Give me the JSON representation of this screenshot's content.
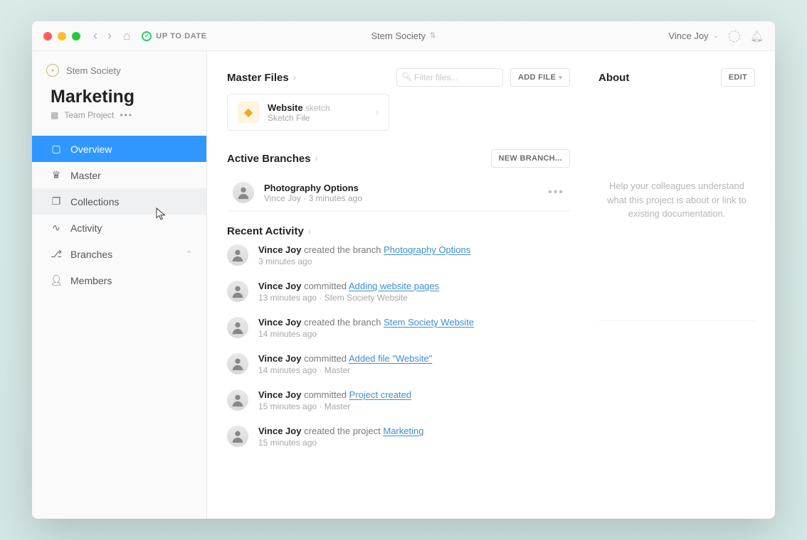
{
  "titlebar": {
    "status_label": "UP TO DATE",
    "center_title": "Stem Society",
    "user_name": "Vince Joy"
  },
  "sidebar": {
    "org_name": "Stem Society",
    "project_title": "Marketing",
    "project_subtitle": "Team Project",
    "items": [
      {
        "label": "Overview"
      },
      {
        "label": "Master"
      },
      {
        "label": "Collections"
      },
      {
        "label": "Activity"
      },
      {
        "label": "Branches"
      },
      {
        "label": "Members"
      }
    ]
  },
  "master_files": {
    "heading": "Master Files",
    "filter_placeholder": "Filter files...",
    "add_button": "ADD FILE",
    "file": {
      "name": "Website",
      "ext": ".sketch",
      "type": "Sketch File"
    }
  },
  "branches": {
    "heading": "Active Branches",
    "new_button": "NEW BRANCH...",
    "item": {
      "name": "Photography Options",
      "author": "Vince Joy",
      "time": "3 minutes ago"
    }
  },
  "recent": {
    "heading": "Recent Activity",
    "items": [
      {
        "who": "Vince Joy",
        "action": " created the branch ",
        "link": "Photography Options",
        "sub": "3 minutes ago"
      },
      {
        "who": "Vince Joy",
        "action": " committed ",
        "link": "Adding website pages",
        "sub": "13 minutes ago · Stem Society Website"
      },
      {
        "who": "Vince Joy",
        "action": " created the branch ",
        "link": "Stem Society Website",
        "sub": "14 minutes ago"
      },
      {
        "who": "Vince Joy",
        "action": " committed ",
        "link": "Added file \"Website\"",
        "sub": "14 minutes ago · Master"
      },
      {
        "who": "Vince Joy",
        "action": " committed ",
        "link": "Project created",
        "sub": "15 minutes ago · Master"
      },
      {
        "who": "Vince Joy",
        "action": " created the project ",
        "link": "Marketing",
        "sub": "15 minutes ago"
      }
    ]
  },
  "about": {
    "heading": "About",
    "edit_button": "EDIT",
    "placeholder": "Help your colleagues understand what this project is about or link to existing documentation."
  }
}
